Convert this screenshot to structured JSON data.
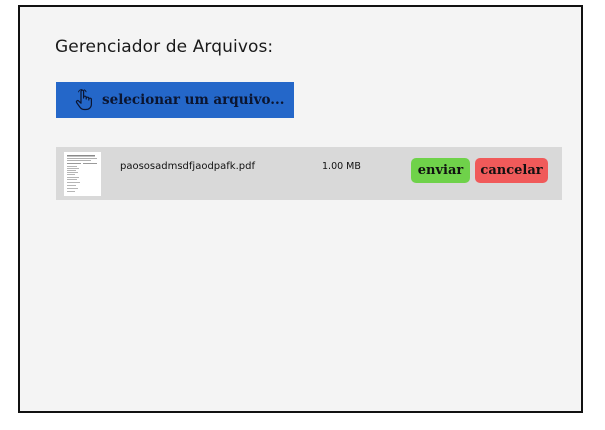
{
  "header": {
    "title": "Gerenciador de Arquivos:"
  },
  "upload": {
    "select_label": "selecionar um arquivo...",
    "icon": "hand-pointer-icon",
    "color": "#2467c9"
  },
  "files": [
    {
      "name": "paososadmsdfjaodpafk.pdf",
      "size": "1.00 MB",
      "thumbnail_icon": "pdf-thumbnail",
      "send_label": "enviar",
      "cancel_label": "cancelar",
      "send_color": "#6fd24a",
      "cancel_color": "#f05a5a"
    }
  ]
}
